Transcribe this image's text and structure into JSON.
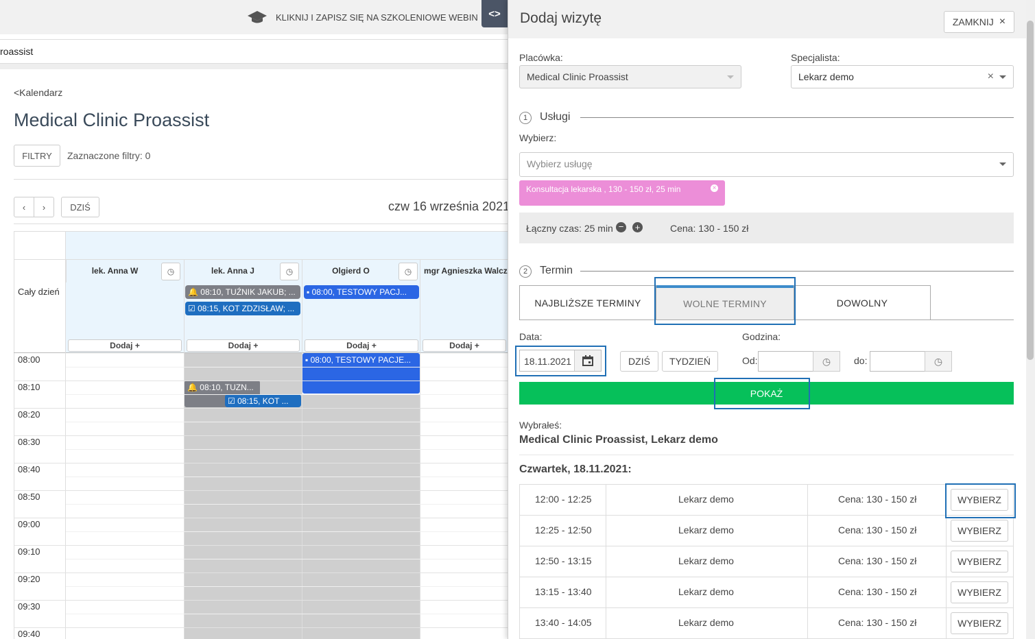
{
  "app": {
    "banner_text": "KLIKNIJ I ZAPISZ SIĘ NA SZKOLENIOWE WEBIN",
    "url_fragment": "roassist",
    "toggle_label": "<>"
  },
  "calendar": {
    "back_link": "<Kalendarz",
    "title": "Medical Clinic Proassist",
    "filters_button": "FILTRY",
    "filters_status": "Zaznaczone filtry: 0",
    "prev": "‹",
    "next": "›",
    "today_button": "DZIŚ",
    "date_heading": "czw 16 września 2021",
    "all_day_label": "Cały dzień",
    "columns": [
      {
        "name": "lek. Anna W",
        "add": "Dodaj +"
      },
      {
        "name": "lek. Anna J",
        "add": "Dodaj +"
      },
      {
        "name": "Olgierd O",
        "add": "Dodaj +"
      },
      {
        "name": "mgr Agnieszka Walcz",
        "add": "Dodaj +"
      }
    ],
    "allday_events": [
      {
        "text": "🔔 08:10, TUŹNIK JAKUB; ..."
      },
      {
        "text": "☑ 08:15, KOT ZDZISŁAW; ..."
      },
      {
        "text": "▪ 08:00, TESTOWY PACJ..."
      }
    ],
    "times": [
      "08:00",
      "08:10",
      "08:20",
      "08:30",
      "08:40",
      "08:50",
      "09:00",
      "09:10",
      "09:20",
      "09:30",
      "09:40"
    ],
    "grid_events": [
      {
        "text": "▪ 08:00, TESTOWY PACJE..."
      },
      {
        "text": "🔔 08:10, TUZN..."
      },
      {
        "text": "☑ 08:15, KOT ..."
      }
    ]
  },
  "panel": {
    "title": "Dodaj wizytę",
    "close_button": "ZAMKNIJ",
    "close_icon": "×",
    "facility_label": "Placówka:",
    "facility_value": "Medical Clinic Proassist",
    "specialist_label": "Specjalista:",
    "specialist_value": "Lekarz demo",
    "specialist_clear": "×",
    "step1_num": "1",
    "step1_title": "Usługi",
    "choose_label": "Wybierz:",
    "service_placeholder": "Wybierz usługę",
    "selected_service": "Konsultacja lekarska , 130 - 150 zł, 25 min",
    "total_time": "Łączny czas: 25 min",
    "price_total": "Cena: 130 - 150 zł",
    "step2_num": "2",
    "step2_title": "Termin",
    "tabs": [
      "NAJBLIŻSZE TERMINY",
      "WOLNE TERMINY",
      "DOWOLNY"
    ],
    "active_tab": "WOLNE TERMINY",
    "date_label": "Data:",
    "date_value": "18.11.2021",
    "today_button": "DZIŚ",
    "week_button": "TYDZIEŃ",
    "hour_label": "Godzina:",
    "from_label": "Od:",
    "to_label": "do:",
    "show_button": "POKAŻ",
    "chosen_label": "Wybrałeś:",
    "chosen_value": "Medical Clinic Proassist, Lekarz demo",
    "day_heading": "Czwartek, 18.11.2021:",
    "slots": [
      {
        "time": "12:00 - 12:25",
        "doctor": "Lekarz demo",
        "price": "Cena: 130 - 150 zł",
        "action": "WYBIERZ"
      },
      {
        "time": "12:25 - 12:50",
        "doctor": "Lekarz demo",
        "price": "Cena: 130 - 150 zł",
        "action": "WYBIERZ"
      },
      {
        "time": "12:50 - 13:15",
        "doctor": "Lekarz demo",
        "price": "Cena: 130 - 150 zł",
        "action": "WYBIERZ"
      },
      {
        "time": "13:15 - 13:40",
        "doctor": "Lekarz demo",
        "price": "Cena: 130 - 150 zł",
        "action": "WYBIERZ"
      },
      {
        "time": "13:40 - 14:05",
        "doctor": "Lekarz demo",
        "price": "Cena: 130 - 150 zł",
        "action": "WYBIERZ"
      }
    ]
  },
  "colors": {
    "accent_green": "#06c05a",
    "highlight_blue": "#1f6fb5",
    "service_pink": "#ec8ed8",
    "event_blue": "#2b66e4",
    "event_grey": "#7d7f86"
  }
}
